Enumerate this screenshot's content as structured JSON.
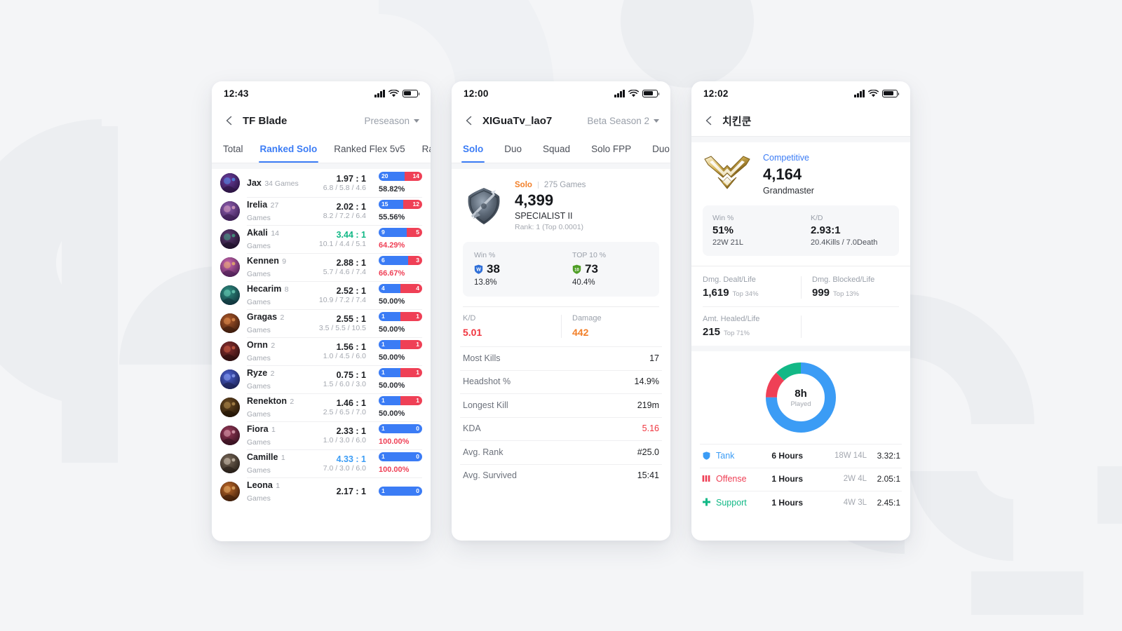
{
  "background": {
    "pattern_color": "#eceef1",
    "page_bg": "#f4f5f7"
  },
  "phone1": {
    "status": {
      "time": "12:43"
    },
    "nav": {
      "title": "TF Blade",
      "season": "Preseason"
    },
    "tabs": [
      {
        "label": "Total",
        "active": false
      },
      {
        "label": "Ranked Solo",
        "active": true
      },
      {
        "label": "Ranked Flex 5v5",
        "active": false
      },
      {
        "label": "Ranke",
        "active": false
      }
    ],
    "champions": [
      {
        "name": "Jax",
        "games": "34 Games",
        "kd": "1.97 : 1",
        "kd_color": "dark",
        "kda": "6.8 / 5.8 / 4.6",
        "wins": "20",
        "losses": "14",
        "wr": "58.82%",
        "wr_color": "dark",
        "w_pct": 59
      },
      {
        "name": "Irelia",
        "games": "27 Games",
        "kd": "2.02 : 1",
        "kd_color": "dark",
        "kda": "8.2 / 7.2 / 6.4",
        "wins": "15",
        "losses": "12",
        "wr": "55.56%",
        "wr_color": "dark",
        "w_pct": 56
      },
      {
        "name": "Akali",
        "games": "14 Games",
        "kd": "3.44 : 1",
        "kd_color": "green",
        "kda": "10.1 / 4.4 / 5.1",
        "wins": "9",
        "losses": "5",
        "wr": "64.29%",
        "wr_color": "red",
        "w_pct": 64
      },
      {
        "name": "Kennen",
        "games": "9 Games",
        "kd": "2.88 : 1",
        "kd_color": "dark",
        "kda": "5.7 / 4.6 / 7.4",
        "wins": "6",
        "losses": "3",
        "wr": "66.67%",
        "wr_color": "red",
        "w_pct": 67
      },
      {
        "name": "Hecarim",
        "games": "8 Games",
        "kd": "2.52 : 1",
        "kd_color": "dark",
        "kda": "10.9 / 7.2 / 7.4",
        "wins": "4",
        "losses": "4",
        "wr": "50.00%",
        "wr_color": "dark",
        "w_pct": 50
      },
      {
        "name": "Gragas",
        "games": "2 Games",
        "kd": "2.55 : 1",
        "kd_color": "dark",
        "kda": "3.5 / 5.5 / 10.5",
        "wins": "1",
        "losses": "1",
        "wr": "50.00%",
        "wr_color": "dark",
        "w_pct": 50
      },
      {
        "name": "Ornn",
        "games": "2 Games",
        "kd": "1.56 : 1",
        "kd_color": "dark",
        "kda": "1.0 / 4.5 / 6.0",
        "wins": "1",
        "losses": "1",
        "wr": "50.00%",
        "wr_color": "dark",
        "w_pct": 50
      },
      {
        "name": "Ryze",
        "games": "2 Games",
        "kd": "0.75 : 1",
        "kd_color": "dark",
        "kda": "1.5 / 6.0 / 3.0",
        "wins": "1",
        "losses": "1",
        "wr": "50.00%",
        "wr_color": "dark",
        "w_pct": 50
      },
      {
        "name": "Renekton",
        "games": "2 Games",
        "kd": "1.46 : 1",
        "kd_color": "dark",
        "kda": "2.5 / 6.5 / 7.0",
        "wins": "1",
        "losses": "1",
        "wr": "50.00%",
        "wr_color": "dark",
        "w_pct": 50
      },
      {
        "name": "Fiora",
        "games": "1 Games",
        "kd": "2.33 : 1",
        "kd_color": "dark",
        "kda": "1.0 / 3.0 / 6.0",
        "wins": "1",
        "losses": "0",
        "wr": "100.00%",
        "wr_color": "red",
        "w_pct": 100
      },
      {
        "name": "Camille",
        "games": "1 Games",
        "kd": "4.33 : 1",
        "kd_color": "blue",
        "kda": "7.0 / 3.0 / 6.0",
        "wins": "1",
        "losses": "0",
        "wr": "100.00%",
        "wr_color": "red",
        "w_pct": 100
      },
      {
        "name": "Leona",
        "games": "1 Games",
        "kd": "2.17 : 1",
        "kd_color": "dark",
        "kda": "",
        "wins": "1",
        "losses": "0",
        "wr": "",
        "wr_color": "dark",
        "w_pct": 100
      }
    ]
  },
  "phone2": {
    "status": {
      "time": "12:00"
    },
    "nav": {
      "title": "XIGuaTv_lao7",
      "season": "Beta Season 2"
    },
    "tabs": [
      {
        "label": "Solo",
        "active": true
      },
      {
        "label": "Duo",
        "active": false
      },
      {
        "label": "Squad",
        "active": false
      },
      {
        "label": "Solo FPP",
        "active": false
      },
      {
        "label": "Duo FPP",
        "active": false
      }
    ],
    "hero": {
      "mode": "Solo",
      "games": "275 Games",
      "score": "4,399",
      "tier": "SPECIALIST II",
      "rank": "Rank: 1 (Top 0.0001)"
    },
    "statbox": [
      {
        "label": "Win %",
        "badge": "W",
        "badge_color": "#2f6fd8",
        "num": "38",
        "sub": "13.8%"
      },
      {
        "label": "TOP 10 %",
        "badge": "10",
        "badge_color": "#4f9e26",
        "num": "73",
        "sub": "40.4%"
      }
    ],
    "kdrow": [
      {
        "label": "K/D",
        "value": "5.01",
        "color": "red"
      },
      {
        "label": "Damage",
        "value": "442",
        "color": "orange"
      }
    ],
    "list": [
      {
        "label": "Most Kills",
        "value": "17",
        "color": "dark"
      },
      {
        "label": "Headshot %",
        "value": "14.9%",
        "color": "dark"
      },
      {
        "label": "Longest Kill",
        "value": "219m",
        "color": "dark"
      },
      {
        "label": "KDA",
        "value": "5.16",
        "color": "red"
      },
      {
        "label": "Avg. Rank",
        "value": "#25.0",
        "color": "dark"
      },
      {
        "label": "Avg. Survived",
        "value": "15:41",
        "color": "dark"
      }
    ]
  },
  "phone3": {
    "status": {
      "time": "12:02"
    },
    "nav": {
      "title": "치킨쿤"
    },
    "hero": {
      "mode": "Competitive",
      "score": "4,164",
      "tier": "Grandmaster"
    },
    "statbox": [
      {
        "label": "Win %",
        "num": "51%",
        "sub": "22W 21L"
      },
      {
        "label": "K/D",
        "num": "2.93:1",
        "sub": "20.4Kills / 7.0Death"
      }
    ],
    "damage": [
      [
        {
          "label": "Dmg. Dealt/Life",
          "value": "1,619",
          "top": "Top 34%"
        },
        {
          "label": "Dmg. Blocked/Life",
          "value": "999",
          "top": "Top 13%"
        }
      ],
      [
        {
          "label": "Amt. Healed/Life",
          "value": "215",
          "top": "Top 71%"
        }
      ]
    ],
    "donut": {
      "center_big": "8h",
      "center_small": "Played"
    },
    "roles": [
      {
        "icon": "tank-icon",
        "name": "Tank",
        "color": "#3b9cf5",
        "hours": "6 Hours",
        "wl": "18W 14L",
        "kd": "3.32:1",
        "share": 75
      },
      {
        "icon": "offense-icon",
        "name": "Offense",
        "color": "#ef4056",
        "hours": "1 Hours",
        "wl": "2W 4L",
        "kd": "2.05:1",
        "share": 12.5
      },
      {
        "icon": "support-icon",
        "name": "Support",
        "color": "#12b886",
        "hours": "1 Hours",
        "wl": "4W 3L",
        "kd": "2.45:1",
        "share": 12.5
      }
    ],
    "chart_data": {
      "type": "pie",
      "title": "Played",
      "categories": [
        "Tank",
        "Offense",
        "Support"
      ],
      "values": [
        6,
        1,
        1
      ],
      "unit": "Hours",
      "colors": [
        "#3b9cf5",
        "#ef4056",
        "#12b886"
      ],
      "total_label": "8h",
      "legend": "bottom-list"
    }
  }
}
